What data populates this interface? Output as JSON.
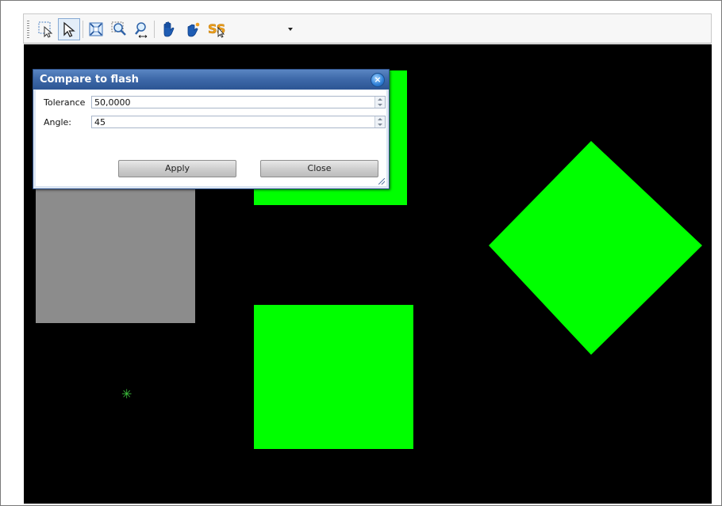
{
  "toolbar": {
    "items": [
      {
        "name": "lasso-select-icon"
      },
      {
        "name": "pointer-select-icon",
        "active": true
      },
      {
        "name": "zoom-extents-icon"
      },
      {
        "name": "zoom-window-icon"
      },
      {
        "name": "zoom-pan-icon"
      },
      {
        "name": "hand-pan-icon"
      },
      {
        "name": "hand-grab-icon"
      },
      {
        "name": "snap-dropdown-icon"
      }
    ]
  },
  "dialog": {
    "title": "Compare to flash",
    "tolerance_label": "Tolerance",
    "tolerance_value": "50,0000",
    "angle_label": "Angle:",
    "angle_value": "45",
    "apply_label": "Apply",
    "close_label": "Close"
  },
  "canvas": {
    "background": "#000000",
    "shape_color": "#00ff00",
    "selected_color": "#8c8c8c"
  }
}
